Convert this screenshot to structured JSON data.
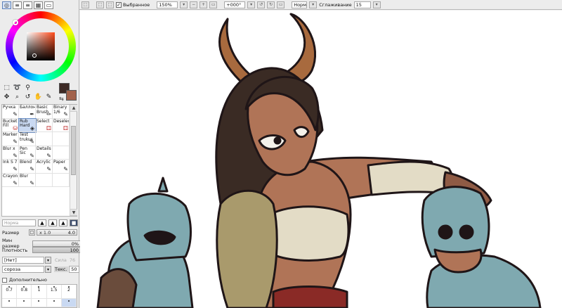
{
  "toolbar": {
    "selection_label": "Выбранное",
    "zoom_value": "150%",
    "rotation_value": "+000°",
    "mode_value": "Норм",
    "stabilizer_label": "Сглаживание",
    "stabilizer_value": "15"
  },
  "brushes": [
    {
      "label": "Ручка"
    },
    {
      "label": "Баллончик"
    },
    {
      "label": "Basic Brush"
    },
    {
      "label": "Binary 1/6"
    },
    {
      "label": "Bucket Fill"
    },
    {
      "label": "Rub Hard"
    },
    {
      "label": "Select"
    },
    {
      "label": "Deselect"
    },
    {
      "label": "Marker"
    },
    {
      "label": "Test trukus"
    },
    {
      "label": ""
    },
    {
      "label": ""
    },
    {
      "label": "Blur x"
    },
    {
      "label": "Pen Sic"
    },
    {
      "label": "Details"
    },
    {
      "label": ""
    },
    {
      "label": "Ink S 7"
    },
    {
      "label": "Blend"
    },
    {
      "label": "Acrylic"
    },
    {
      "label": "Paper"
    },
    {
      "label": "Crayon"
    },
    {
      "label": "Blur"
    },
    {
      "label": ""
    },
    {
      "label": ""
    }
  ],
  "brush_settings": {
    "blend_mode_placeholder": "Норма",
    "size_label": "Размер",
    "size_multiplier": "x 1.0",
    "size_value": "4.0",
    "min_size_label": "Мин размер",
    "min_size_value": "0%",
    "density_label": "Плотность",
    "density_value": "100",
    "paper_value": "[Нет]",
    "paper_strength_label": "Сила",
    "paper_strength_value": "76",
    "texture_value": "cороза",
    "texture_label": "Текс.",
    "texture_strength_value": "50",
    "extra_label": "Дополнительно"
  },
  "size_presets": [
    {
      "label": "0.7"
    },
    {
      "label": "0.8"
    },
    {
      "label": "1"
    },
    {
      "label": "1.5"
    },
    {
      "label": "2"
    }
  ],
  "colors": {
    "main_color": "#3d2a25",
    "sub_color": "#a2624b",
    "accent": "#c9d9f2"
  }
}
